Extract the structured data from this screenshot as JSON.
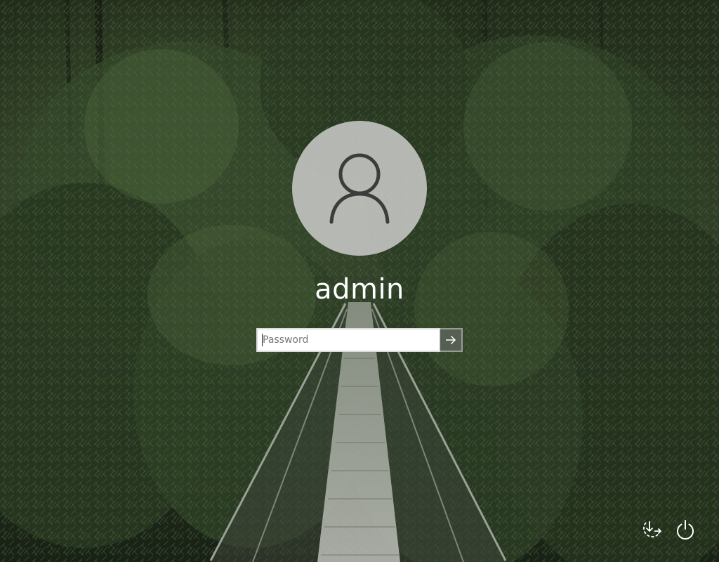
{
  "lockscreen": {
    "username": "admin",
    "password_placeholder": "Password",
    "password_value": ""
  },
  "icons": {
    "avatar": "user-silhouette-icon",
    "submit": "arrow-right-icon",
    "ease_of_access": "ease-of-access-icon",
    "power": "power-icon"
  },
  "colors": {
    "avatar_bg": "#c8c8c6",
    "avatar_glyph": "#3c3c3c",
    "text": "#ffffff",
    "forest_dark": "#1f2a1c",
    "forest_mid": "#3e5236",
    "forest_light": "#6d8a55"
  }
}
